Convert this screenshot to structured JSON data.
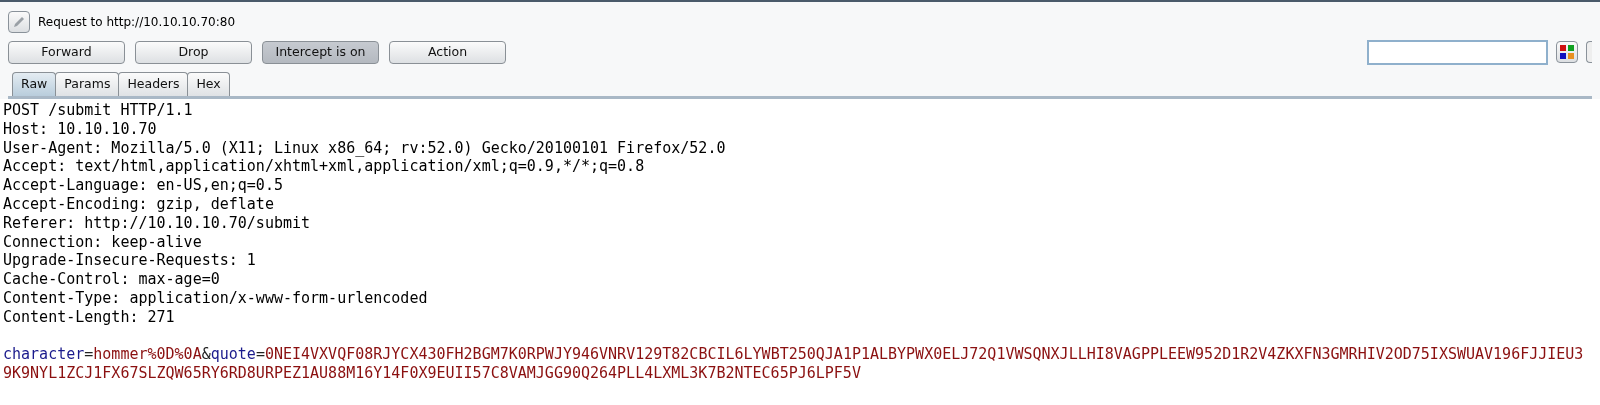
{
  "request_title": "Request to http://10.10.10.70:80",
  "buttons": [
    {
      "label": "Forward",
      "selected": false
    },
    {
      "label": "Drop",
      "selected": false
    },
    {
      "label": "Intercept is on",
      "selected": true
    },
    {
      "label": "Action",
      "selected": false
    }
  ],
  "tabs": [
    {
      "label": "Raw",
      "selected": true
    },
    {
      "label": "Params",
      "selected": false
    },
    {
      "label": "Headers",
      "selected": false
    },
    {
      "label": "Hex",
      "selected": false
    }
  ],
  "request_lines": [
    "POST /submit HTTP/1.1",
    "Host: 10.10.10.70",
    "User-Agent: Mozilla/5.0 (X11; Linux x86_64; rv:52.0) Gecko/20100101 Firefox/52.0",
    "Accept: text/html,application/xhtml+xml,application/xml;q=0.9,*/*;q=0.8",
    "Accept-Language: en-US,en;q=0.5",
    "Accept-Encoding: gzip, deflate",
    "Referer: http://10.10.10.70/submit",
    "Connection: keep-alive",
    "Upgrade-Insecure-Requests: 1",
    "Cache-Control: max-age=0",
    "Content-Type: application/x-www-form-urlencoded",
    "Content-Length: 271"
  ],
  "body": [
    {
      "kind": "name",
      "text": "character"
    },
    {
      "kind": "sep",
      "text": "="
    },
    {
      "kind": "value",
      "text": "hommer%0D%0A"
    },
    {
      "kind": "sep",
      "text": "&"
    },
    {
      "kind": "name",
      "text": "quote"
    },
    {
      "kind": "sep",
      "text": "="
    },
    {
      "kind": "value",
      "text": "0NEI4VXVQF08RJYCX430FH2BGM7K0RPWJY946VNRV129T82CBCIL6LYWBT250QJA1P1ALBYPWX0ELJ72Q1VWSQNXJLLHI8VAGPPLEEW952D1R2V4ZKXFN3GMRHIV2OD75IXSWUAV196FJJIEU39K9NYL1ZCJ1FX67SLZQW65RY6RD8URPEZ1AU88M16Y14F0X9EUII57C8VAMJGG90Q264PLL4LXML3K7B2NTEC65PJ6LPF5V"
    }
  ]
}
